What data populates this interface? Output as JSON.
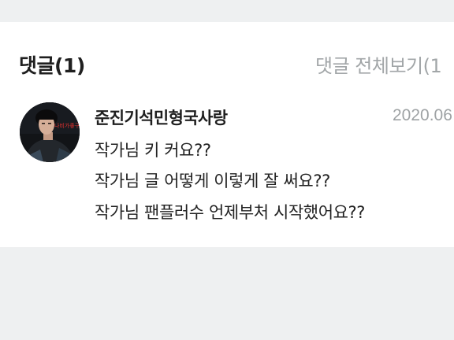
{
  "comments_section": {
    "title": "댓글(1)",
    "view_all_label": "댓글 전체보기(1"
  },
  "comment": {
    "avatar_icon": "profile-photo-avatar",
    "avatar_overlay_text": "나비가좋구나",
    "author": "준진기석민형국사랑",
    "date": "2020.06",
    "lines": [
      "작가님 키 커요??",
      "작가님 글 어떻게 이렇게 잘 써요??",
      "작가님 팬플러수 언제부처 시작했어요??"
    ]
  },
  "colors": {
    "page_background": "#eef0f1",
    "card_background": "#ffffff",
    "title_text": "#1f1f1f",
    "muted_text": "#a2a6a8",
    "body_text": "#222222"
  }
}
